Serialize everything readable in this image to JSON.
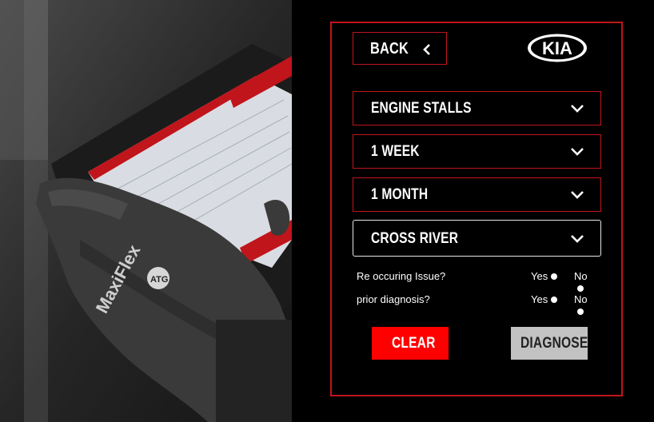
{
  "back_label": "BACK",
  "brand": "KIA",
  "selects": [
    {
      "value": "ENGINE STALLS"
    },
    {
      "value": "1 WEEK"
    },
    {
      "value": "1 MONTH"
    },
    {
      "value": "CROSS RIVER"
    }
  ],
  "questions": [
    {
      "label": "Re occuring Issue?",
      "yes": "Yes",
      "no": "No"
    },
    {
      "label": "prior diagnosis?",
      "yes": "Yes",
      "no": "No"
    }
  ],
  "clear_label": "CLEAR",
  "diagnose_label": "DIAGNOSE",
  "photo": {
    "glove_text": "MaxiFlex",
    "glove_badge": "ATG"
  },
  "colors": {
    "accent": "#c0151b",
    "clear_bg": "#ff0000",
    "diagnose_bg": "#c2c2c2",
    "panel_bg": "#000000"
  }
}
